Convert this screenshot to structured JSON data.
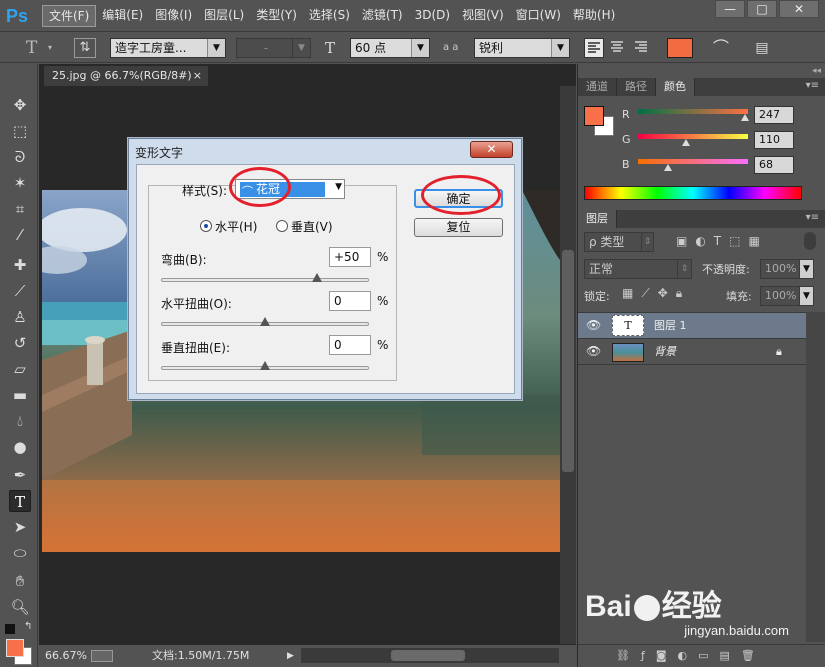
{
  "app": {
    "logo": "Ps"
  },
  "menu": [
    "文件(F)",
    "编辑(E)",
    "图像(I)",
    "图层(L)",
    "类型(Y)",
    "选择(S)",
    "滤镜(T)",
    "3D(D)",
    "视图(V)",
    "窗口(W)",
    "帮助(H)"
  ],
  "window_controls": {
    "minimize": "—",
    "maximize": "□",
    "close": "✕"
  },
  "options": {
    "tool_glyph": "T",
    "font_family": "造字工房童...",
    "font_style": "-",
    "size_icon": "T",
    "font_size": "60 点",
    "aa_icon": "a a",
    "antialias": "锐利",
    "text_color": "#f26b41"
  },
  "document": {
    "tab": "25.jpg @ 66.7%(RGB/8#)",
    "tab_close": "×"
  },
  "status": {
    "zoom": "66.67%",
    "doc": "文档:1.50M/1.75M"
  },
  "color_panel": {
    "tabs": [
      "通道",
      "路径",
      "颜色"
    ],
    "fg_color": "#f7704a",
    "bg_color": "#ffffff",
    "channels": [
      {
        "label": "R",
        "value": "247"
      },
      {
        "label": "G",
        "value": "110"
      },
      {
        "label": "B",
        "value": "68"
      }
    ]
  },
  "layers_panel": {
    "tab": "图层",
    "filter": "ρ 类型",
    "blend": "正常",
    "opacity_label": "不透明度:",
    "opacity": "100%",
    "lock_label": "锁定:",
    "fill_label": "填充:",
    "fill": "100%",
    "layers": [
      {
        "name": "图层 1",
        "thumb": "T"
      },
      {
        "name": "背景"
      }
    ]
  },
  "dialog": {
    "title": "变形文字",
    "close": "✕",
    "style_label": "样式(S):",
    "style_value": "花冠",
    "horizontal": "水平(H)",
    "vertical": "垂直(V)",
    "bend_label": "弯曲(B):",
    "bend_value": "+50",
    "hdist_label": "水平扭曲(O):",
    "hdist_value": "0",
    "vdist_label": "垂直扭曲(E):",
    "vdist_value": "0",
    "percent": "%",
    "ok": "确定",
    "reset": "复位",
    "bend_fraction": 0.75,
    "hdist_fraction": 0.5,
    "vdist_fraction": 0.5
  },
  "watermark": {
    "brand": "Bai",
    "brand2": "经验",
    "url": "jingyan.baidu.com"
  }
}
